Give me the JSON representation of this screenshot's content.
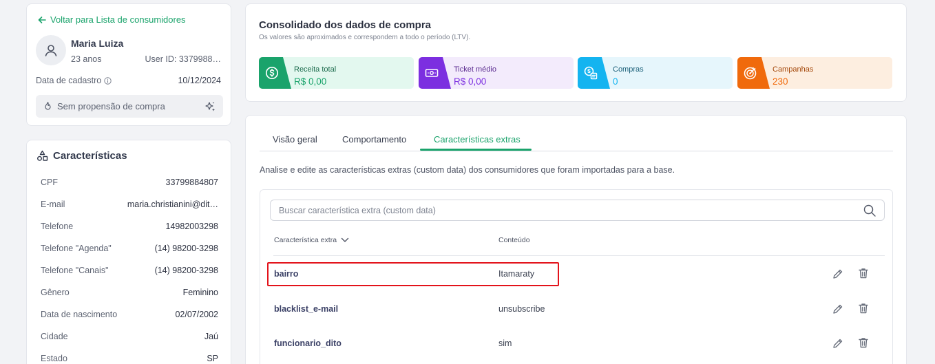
{
  "profile": {
    "back_link": "Voltar para Lista de consumidores",
    "name": "Maria Luiza",
    "age": "23 anos",
    "user_id": "User ID: 3379988…",
    "reg_label": "Data de cadastro",
    "reg_value": "10/12/2024",
    "propensity": "Sem propensão de compra"
  },
  "characteristics": {
    "title": "Características",
    "rows": [
      {
        "label": "CPF",
        "value": "33799884807"
      },
      {
        "label": "E-mail",
        "value": "maria.christianini@dit…"
      },
      {
        "label": "Telefone",
        "value": "14982003298"
      },
      {
        "label": "Telefone \"Agenda\"",
        "value": "(14) 98200-3298"
      },
      {
        "label": "Telefone \"Canais\"",
        "value": "(14) 98200-3298"
      },
      {
        "label": "Gênero",
        "value": "Feminino"
      },
      {
        "label": "Data de nascimento",
        "value": "02/07/2002"
      },
      {
        "label": "Cidade",
        "value": "Jaú"
      },
      {
        "label": "Estado",
        "value": "SP"
      }
    ]
  },
  "summary": {
    "title": "Consolidado dos dados de compra",
    "subtitle": "Os valores são aproximados e correspondem a todo o período (LTV).",
    "kpis": [
      {
        "label": "Receita total",
        "value": "R$ 0,00",
        "icon": "dollar-coin-icon",
        "accent": "#1aa36b",
        "bg": "#e3f8ef"
      },
      {
        "label": "Ticket médio",
        "value": "R$ 0,00",
        "icon": "banknote-icon",
        "accent": "#7c2fe0",
        "bg": "#f3ebfc"
      },
      {
        "label": "Compras",
        "value": "0",
        "icon": "coins-receipt-icon",
        "accent": "#14b4f0",
        "bg": "#e6f6fc"
      },
      {
        "label": "Campanhas",
        "value": "230",
        "icon": "target-icon",
        "accent": "#f06a0c",
        "bg": "#fdeee0"
      }
    ]
  },
  "tabs": {
    "items": [
      "Visão geral",
      "Comportamento",
      "Características extras"
    ],
    "active": "Características extras"
  },
  "extras": {
    "description": "Analise e edite as características extras (custom data) dos consumidores que foram importadas para a base.",
    "search_placeholder": "Buscar característica extra (custom data)",
    "col_key": "Característica extra",
    "col_value": "Conteúdo",
    "rows": [
      {
        "key": "bairro",
        "value": "Itamaraty"
      },
      {
        "key": "blacklist_e-mail",
        "value": "unsubscribe"
      },
      {
        "key": "funcionario_dito",
        "value": "sim"
      }
    ]
  }
}
